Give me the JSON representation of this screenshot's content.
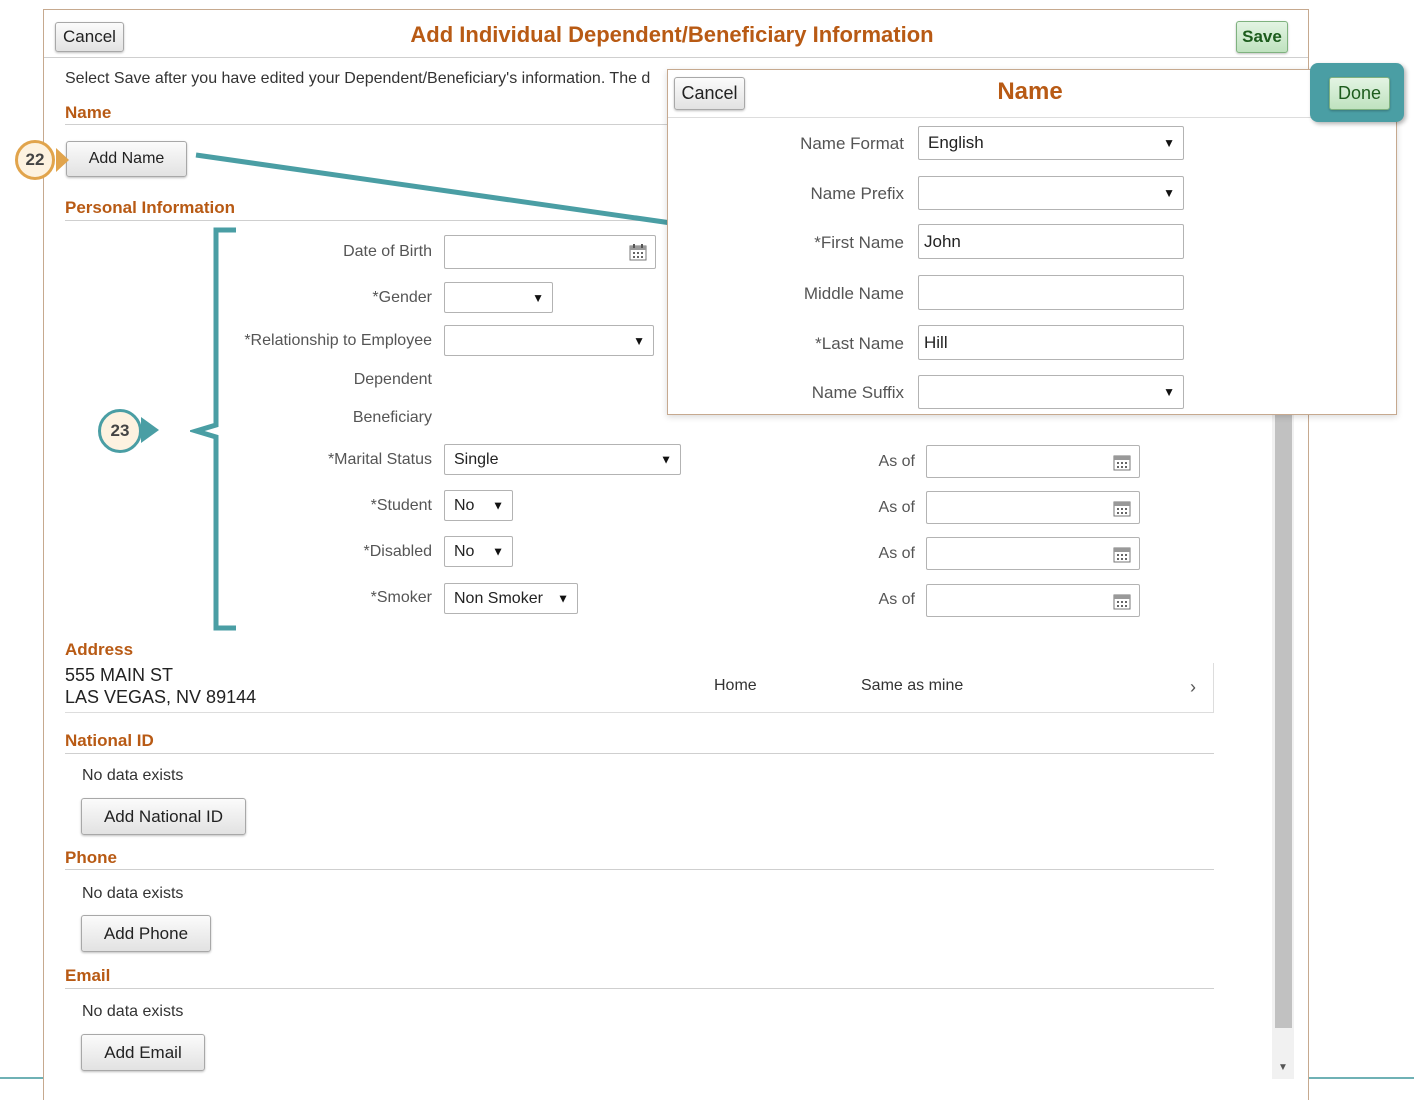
{
  "dialog": {
    "cancel_label": "Cancel",
    "title": "Add Individual Dependent/Beneficiary Information",
    "save_label": "Save",
    "instruction": "Select Save after you have edited your Dependent/Beneficiary's information.  The d"
  },
  "name_section": {
    "heading": "Name",
    "add_button": "Add Name",
    "callout": "22"
  },
  "personal": {
    "heading": "Personal Information",
    "callout": "23",
    "date_of_birth_label": "Date of Birth",
    "gender_label": "*Gender",
    "relationship_label": "*Relationship to Employee",
    "dependent_label": "Dependent",
    "beneficiary_label": "Beneficiary",
    "marital_label": "*Marital Status",
    "marital_value": "Single",
    "student_label": "*Student",
    "student_value": "No",
    "disabled_label": "*Disabled",
    "disabled_value": "No",
    "smoker_label": "*Smoker",
    "smoker_value": "Non Smoker",
    "as_of_label": "As of"
  },
  "address": {
    "heading": "Address",
    "line1": "555 MAIN ST",
    "line2": "LAS VEGAS, NV 89144",
    "type": "Home",
    "same": "Same as mine"
  },
  "national_id": {
    "heading": "National ID",
    "empty": "No data exists",
    "add_button": "Add National ID"
  },
  "phone": {
    "heading": "Phone",
    "empty": "No data exists",
    "add_button": "Add Phone"
  },
  "email": {
    "heading": "Email",
    "empty": "No data exists",
    "add_button": "Add Email"
  },
  "name_popup": {
    "cancel_label": "Cancel",
    "title": "Name",
    "done_label": "Done",
    "name_format_label": "Name Format",
    "name_format_value": "English",
    "name_prefix_label": "Name Prefix",
    "name_prefix_value": "",
    "first_name_label": "*First Name",
    "first_name_value": "John",
    "middle_name_label": "Middle Name",
    "middle_name_value": "",
    "last_name_label": "*Last Name",
    "last_name_value": "Hill",
    "name_suffix_label": "Name Suffix",
    "name_suffix_value": ""
  },
  "colors": {
    "accent": "#b85a14",
    "callout_teal": "#4a9ea4",
    "save_green": "#bfe2bf"
  }
}
